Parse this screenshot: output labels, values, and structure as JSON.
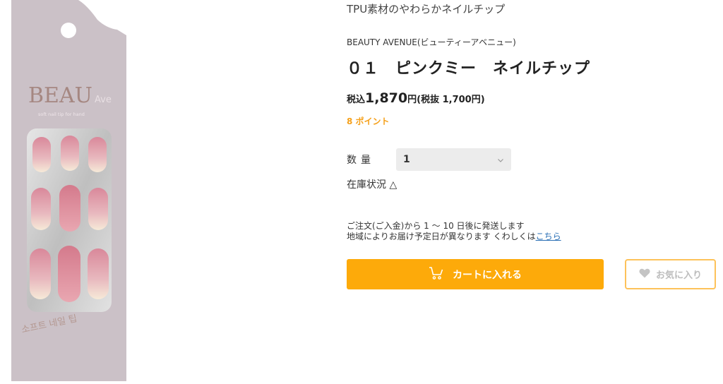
{
  "product": {
    "subtitle": "TPU素材のやわらかネイルチップ",
    "brand": "BEAUTY AVENUE(ビューティーアベニュー)",
    "name": "０１　ピンクミー　ネイルチップ",
    "price": {
      "tax_label": "税込",
      "amount": "1,870",
      "tail": "円(税抜 1,700円)"
    },
    "points": "8 ポイント"
  },
  "package": {
    "logo_main": "BEAU",
    "logo_sub": "Ave",
    "tagline": "soft nail tip for hand",
    "korean_text": "소프트 네일 팁"
  },
  "quantity": {
    "label": "数量",
    "value": "1"
  },
  "stock": {
    "label": "在庫状況",
    "symbol": "△"
  },
  "shipping": {
    "line1": "ご注文(ご入金)から 1 ～ 10 日後に発送します",
    "line2": "地域によりお届け予定日が異なります くわしくは",
    "link": "こちら"
  },
  "buttons": {
    "cart": "カートに入れる",
    "favorite": "お気に入り"
  },
  "colors": {
    "accent": "#fdaa0a",
    "points": "#f5a01a",
    "package_bg": "#c9bec4",
    "link": "#2a6fb5"
  }
}
